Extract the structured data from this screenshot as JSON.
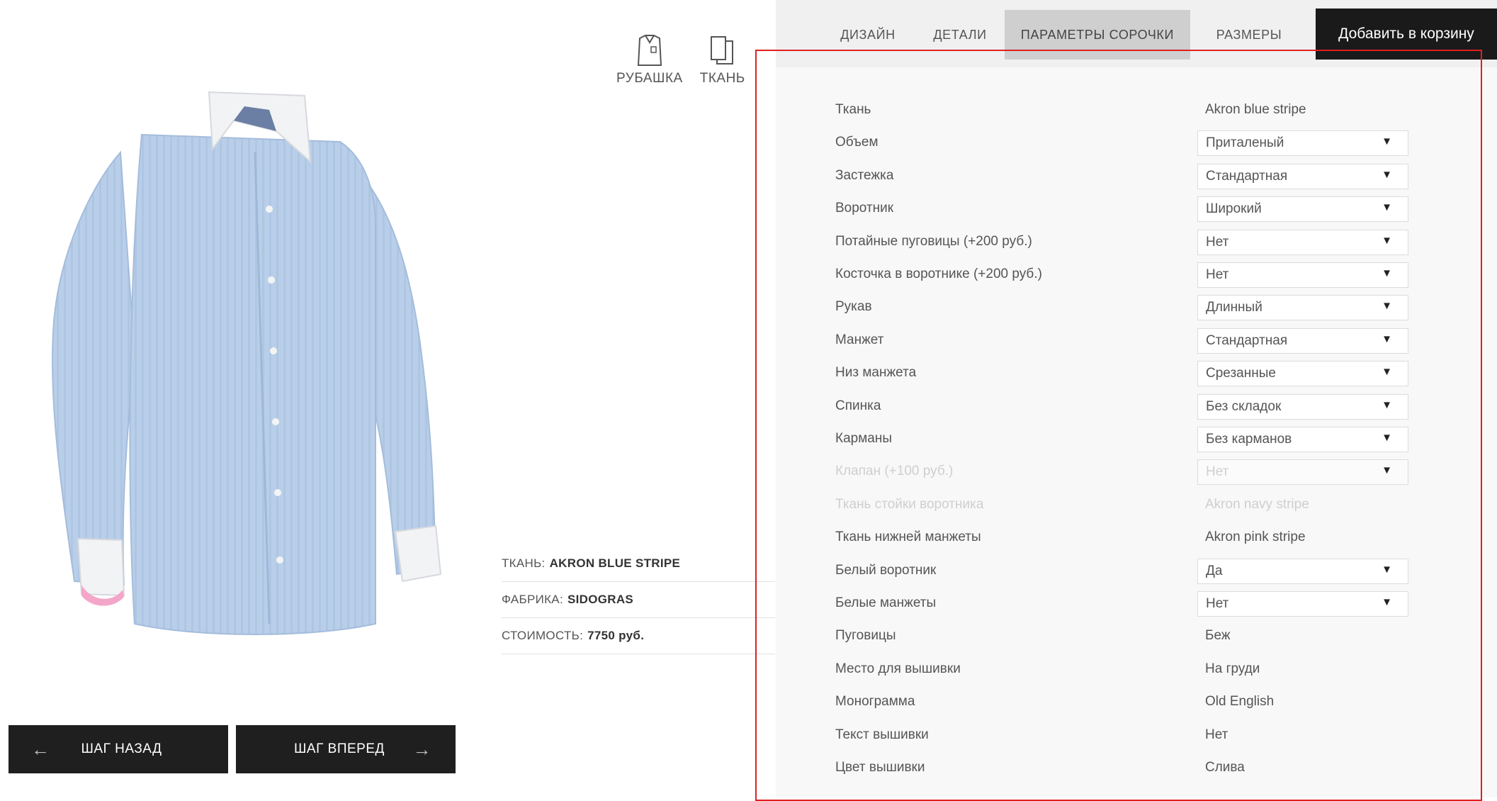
{
  "view_switch": [
    {
      "label": "РУБАШКА",
      "icon": "shirt-icon"
    },
    {
      "label": "ТКАНЬ",
      "icon": "fabric-icon"
    }
  ],
  "info": {
    "fabric_label": "ТКАНЬ:",
    "fabric_value": "AKRON BLUE STRIPE",
    "factory_label": "ФАБРИКА:",
    "factory_value": "SIDOGRAS",
    "price_label": "СТОИМОСТЬ:",
    "price_value": "7750 руб."
  },
  "nav": {
    "back_label": "ШАГ НАЗАД",
    "next_label": "ШАГ ВПЕРЕД",
    "back_icon": "arrow-left-icon",
    "next_icon": "arrow-right-icon"
  },
  "tabs": [
    {
      "label": "ДИЗАЙН"
    },
    {
      "label": "ДЕТАЛИ"
    },
    {
      "label": "ПАРАМЕТРЫ СОРОЧКИ",
      "active": true
    },
    {
      "label": "РАЗМЕРЫ"
    }
  ],
  "cart_label": "Добавить в корзину",
  "params": [
    {
      "label": "Ткань",
      "value": "Akron blue stripe",
      "type": "text"
    },
    {
      "label": "Объем",
      "value": "Приталеный",
      "type": "select"
    },
    {
      "label": "Застежка",
      "value": "Стандартная",
      "type": "select"
    },
    {
      "label": "Воротник",
      "value": "Широкий",
      "type": "select"
    },
    {
      "label": "Потайные пуговицы (+200 руб.)",
      "value": "Нет",
      "type": "select"
    },
    {
      "label": "Косточка в воротнике (+200 руб.)",
      "value": "Нет",
      "type": "select"
    },
    {
      "label": "Рукав",
      "value": "Длинный",
      "type": "select"
    },
    {
      "label": "Манжет",
      "value": "Стандартная",
      "type": "select"
    },
    {
      "label": "Низ манжета",
      "value": "Срезанные",
      "type": "select"
    },
    {
      "label": "Спинка",
      "value": "Без складок",
      "type": "select"
    },
    {
      "label": "Карманы",
      "value": "Без карманов",
      "type": "select"
    },
    {
      "label": "Клапан (+100 руб.)",
      "value": "Нет",
      "type": "select",
      "disabled": true
    },
    {
      "label": "Ткань стойки воротника",
      "value": "Akron navy stripe",
      "type": "text",
      "disabled": true
    },
    {
      "label": "Ткань нижней манжеты",
      "value": "Akron pink stripe",
      "type": "text"
    },
    {
      "label": "Белый воротник",
      "value": "Да",
      "type": "select"
    },
    {
      "label": "Белые манжеты",
      "value": "Нет",
      "type": "select"
    },
    {
      "label": "Пуговицы",
      "value": "Беж",
      "type": "text"
    },
    {
      "label": "Место для вышивки",
      "value": "На груди",
      "type": "text"
    },
    {
      "label": "Монограмма",
      "value": "Old English",
      "type": "text"
    },
    {
      "label": "Текст вышивки",
      "value": "Нет",
      "type": "text"
    },
    {
      "label": "Цвет вышивки",
      "value": "Слива",
      "type": "text"
    }
  ],
  "colors": {
    "shirt": "#b9cfe9",
    "collar": "#f2f3f5",
    "cuff_accent": "#f4a6c8",
    "dark_button": "#1f1f1f",
    "highlight": "#e02020"
  }
}
